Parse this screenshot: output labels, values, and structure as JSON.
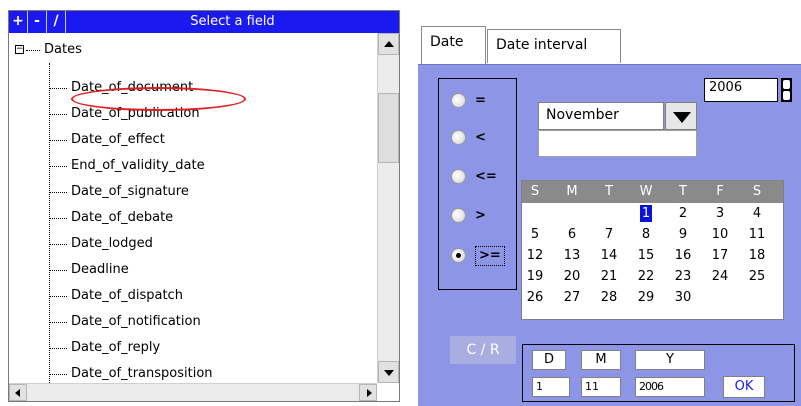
{
  "tree_panel": {
    "toolbar": {
      "buttons": [
        "+",
        "-",
        "/"
      ],
      "title": "Select a field",
      "background": "#1a1af0"
    },
    "root": {
      "expander": "−",
      "label": "Dates"
    },
    "items": [
      "Date_of_document",
      "Date_of_publication",
      "Date_of_effect",
      "End_of_validity_date",
      "Date_of_signature",
      "Date_of_debate",
      "Date_lodged",
      "Deadline",
      "Date_of_dispatch",
      "Date_of_notification",
      "Date_of_reply",
      "Date_of_transposition"
    ],
    "highlighted_item": "Date_of_document",
    "highlight_color": "#e02020"
  },
  "tabs": [
    "Date",
    "Date interval"
  ],
  "active_tab": "Date",
  "date_panel": {
    "background": "#8d96e6",
    "operators": [
      {
        "label": "=",
        "checked": false
      },
      {
        "label": "<",
        "checked": false
      },
      {
        "label": "<=",
        "checked": false
      },
      {
        "label": ">",
        "checked": false
      },
      {
        "label": ">=",
        "checked": true
      }
    ],
    "year": "2006",
    "month": "November",
    "calendar": {
      "day_headers": [
        "S",
        "M",
        "T",
        "W",
        "T",
        "F",
        "S"
      ],
      "weeks": [
        [
          "",
          "",
          "",
          "1",
          "2",
          "3",
          "4"
        ],
        [
          "5",
          "6",
          "7",
          "8",
          "9",
          "10",
          "11"
        ],
        [
          "12",
          "13",
          "14",
          "15",
          "16",
          "17",
          "18"
        ],
        [
          "19",
          "20",
          "21",
          "22",
          "23",
          "24",
          "25"
        ],
        [
          "26",
          "27",
          "28",
          "29",
          "30",
          "",
          ""
        ]
      ],
      "selected_day": "1",
      "selected_color": "#0a13d8"
    },
    "cr_button": "C / R",
    "dmy": {
      "labels": [
        "D",
        "M",
        "Y"
      ],
      "values": [
        "1",
        "11",
        "2006"
      ],
      "ok_label": "OK"
    }
  }
}
